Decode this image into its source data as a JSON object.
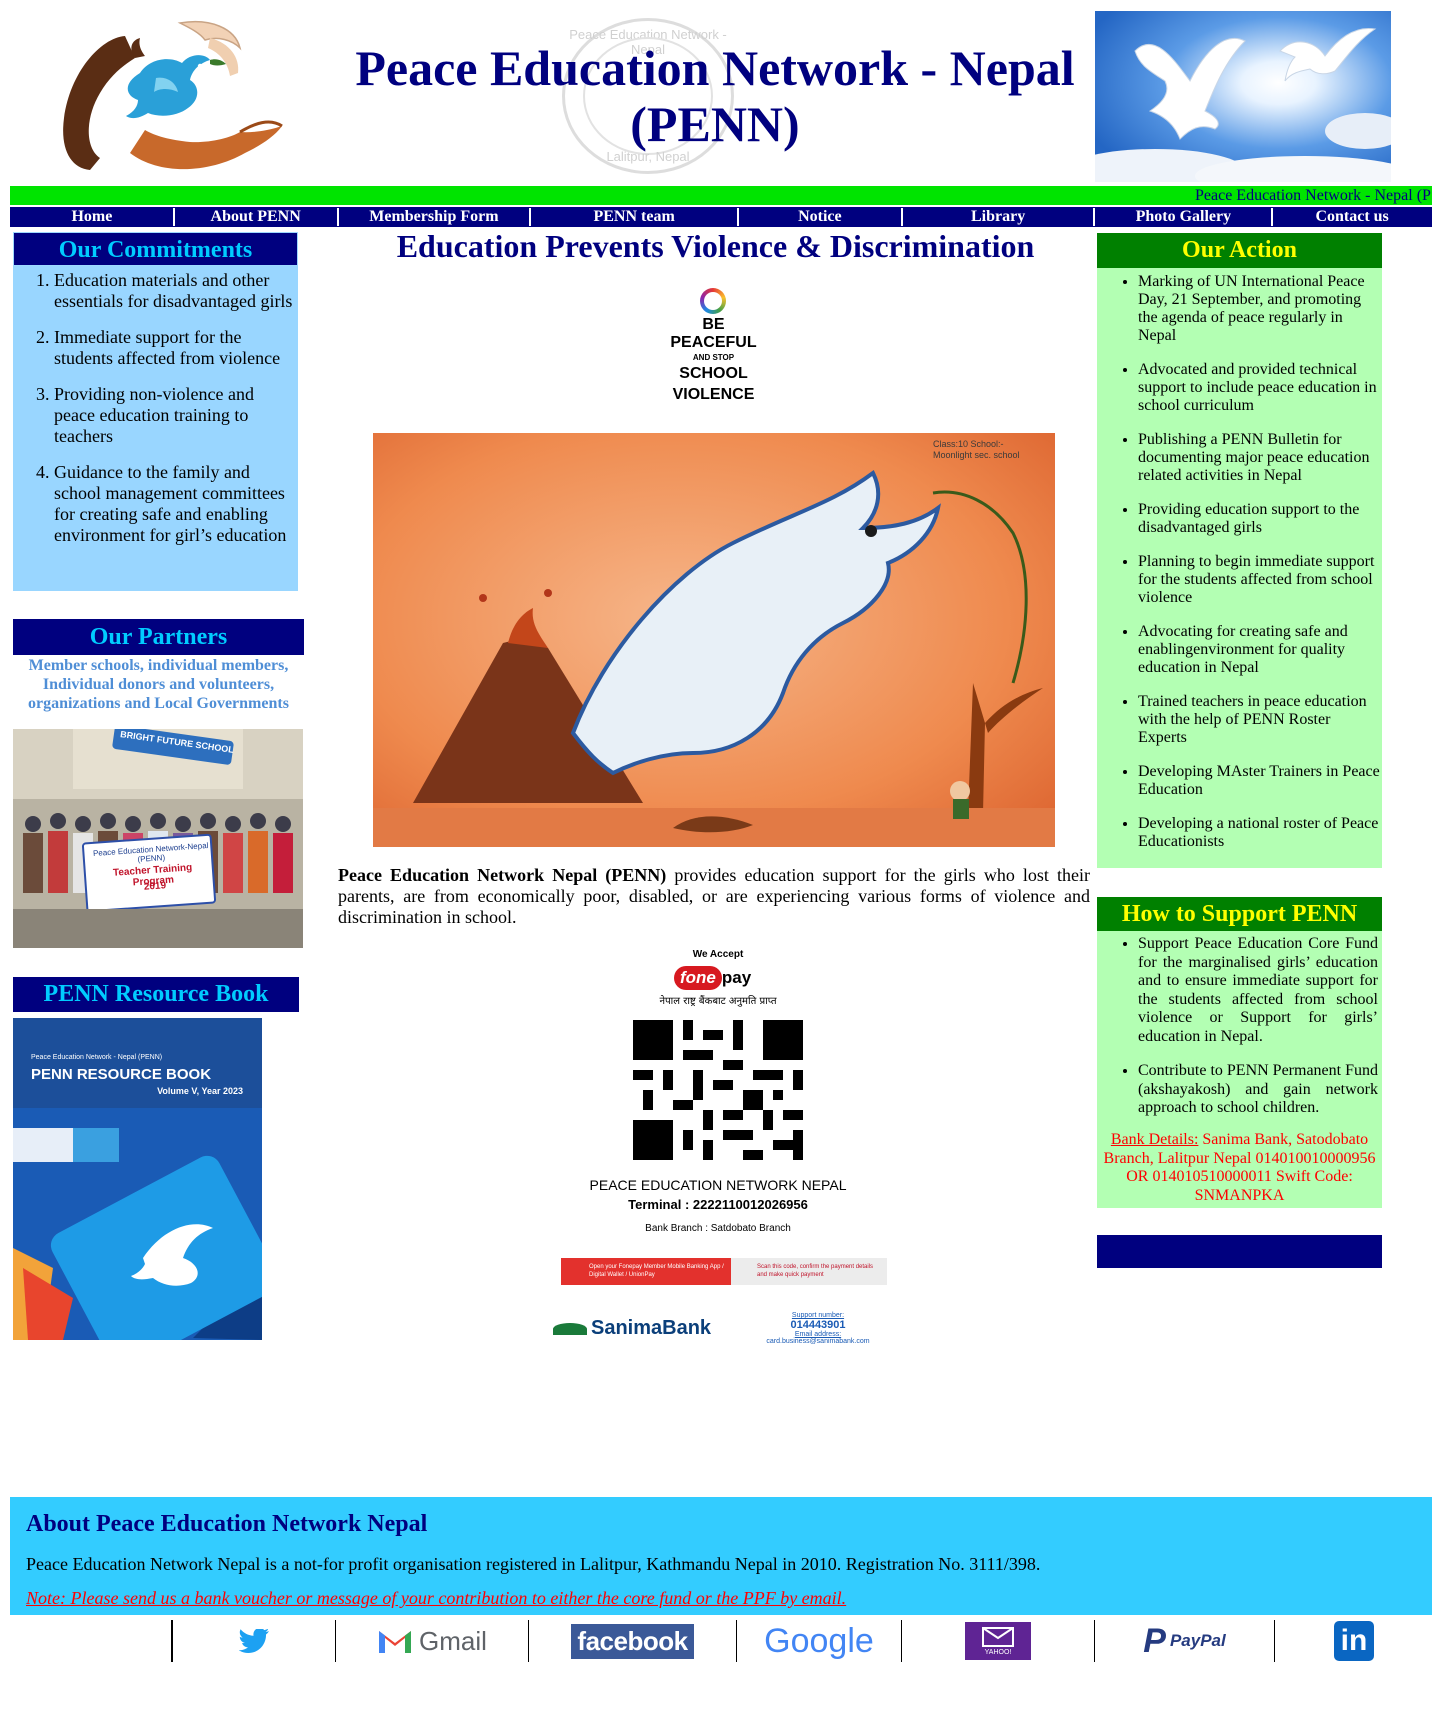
{
  "header": {
    "title_line1": "Peace Education Network - Nepal",
    "title_line2": "(PENN)",
    "seal_top": "Peace Education Network - Nepal",
    "seal_bottom": "Lalitpur, Nepal"
  },
  "marquee": {
    "text": "Peace Education Network - Nepal (P"
  },
  "nav": [
    {
      "label": "Home"
    },
    {
      "label": "About PENN"
    },
    {
      "label": "Membership Form"
    },
    {
      "label": "PENN team"
    },
    {
      "label": "Notice"
    },
    {
      "label": "Library"
    },
    {
      "label": "Photo Gallery"
    },
    {
      "label": "Contact us"
    }
  ],
  "commitments": {
    "title": "Our Commitments",
    "items": [
      "Education materials and other essentials for disadvantaged girls",
      "Immediate support for the students affected from violence",
      "Providing non-violence and peace education training to teachers",
      "Guidance to the family and school management committees for creating safe and enabling environment for girl’s education"
    ]
  },
  "partners": {
    "title": "Our Partners",
    "text": "Member schools, individual members, Individual donors and volunteers, organizations and Local Governments",
    "photo": {
      "banner_line1": "Peace Education Network-Nepal (PENN)",
      "banner_line2": "Teacher Training Program",
      "banner_line3": "2019",
      "sign": "BRIGHT FUTURE SCHOOL"
    }
  },
  "resource": {
    "title": "PENN Resource Book",
    "cover_small": "Peace Education Network - Nepal (PENN)",
    "cover_title": "PENN RESOURCE BOOK",
    "cover_volume": "Volume V, Year 2023"
  },
  "main": {
    "heading": "Education Prevents Violence & Discrimination",
    "poster_lines": [
      "BE",
      "PEACEFUL",
      "AND STOP",
      "SCHOOL",
      "VIOLENCE"
    ],
    "drawing_caption": "Class:10 School:- Moonlight sec. school",
    "intro_bold": "Peace Education Network Nepal (PENN)",
    "intro_rest": " provides education support for the girls who lost their parents, are from economically poor, disabled, or are experiencing various forms of violence and discrimination in school."
  },
  "payment": {
    "we_accept": "We Accept",
    "fone": "fone",
    "pay": "pay",
    "nepali": "नेपाल राष्ट्र बैंकबाट अनुमति प्राप्त",
    "org": "PEACE EDUCATION NETWORK NEPAL",
    "terminal": "Terminal : 2222110012026956",
    "branch": "Bank Branch : Satdobato Branch",
    "step1": "Open your Fonepay Member Mobile Banking App / Digital Wallet / UnionPay",
    "step2": "Scan this code, confirm the payment details and make quick payment",
    "bank_name": "SanimaBank",
    "support_label": "Support number:",
    "support_number": "014443901",
    "email_label": "Email address:",
    "email": "card.business@sanimabank.com"
  },
  "action": {
    "title": "Our Action",
    "items": [
      "Marking of UN International Peace Day, 21 September, and promoting the agenda of peace regularly in Nepal",
      "Advocated and provided technical support to include peace education in school curriculum",
      "Publishing a PENN Bulletin for documenting major peace education related activities in Nepal",
      "Providing education support to the disadvantaged girls",
      "Planning to begin immediate support for the students affected from school violence",
      "Advocating for creating safe and enablingenvironment for quality education in Nepal",
      "Trained teachers in peace education with the help of PENN Roster Experts",
      "Developing MAster Trainers in Peace Education",
      "Developing a national roster of Peace Educationists"
    ]
  },
  "support": {
    "title": "How to Support PENN",
    "items": [
      "Support Peace Education Core Fund for the marginalised girls’ education and to ensure immediate support for the students affected from school violence or Support for girls’ education in Nepal.",
      "Contribute to PENN Permanent Fund (akshayakosh) and gain network approach to school children."
    ],
    "bank_label": "Bank Details:",
    "bank_text": " Sanima Bank, Satodobato Branch, Lalitpur Nepal 014010010000956 OR 014010510000011 Swift Code: SNMANPKA"
  },
  "footer": {
    "heading": "About Peace Education Network Nepal",
    "text": "Peace Education Network Nepal is a not-for profit organisation registered in Lalitpur, Kathmandu Nepal in 2010. Registration No. 3111/398.",
    "note": "Note: Please send us a bank voucher or message of your contribution to either the core fund or the PPF by email."
  },
  "social": {
    "gmail": "Gmail",
    "facebook": "facebook",
    "google": "Google",
    "yahoo": "YAHOO!",
    "paypal": "PayPal",
    "linkedin": "in"
  },
  "colors": {
    "navy": "#00007f",
    "green_bar": "#00e400",
    "light_blue": "#99d6ff",
    "light_green": "#b3ffb3",
    "footer_blue": "#33ccff",
    "cyan_title": "#00ccff",
    "yellow_title": "#ffff00"
  }
}
